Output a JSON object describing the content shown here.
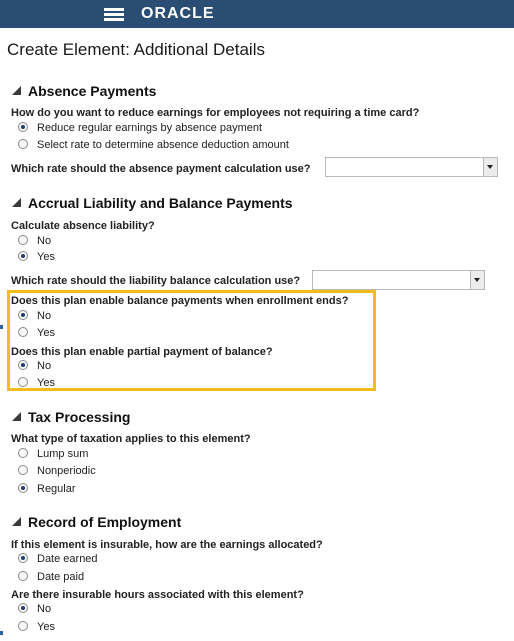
{
  "header": {
    "brand": "ORACLE"
  },
  "page": {
    "title": "Create Element: Additional Details"
  },
  "absence_payments": {
    "title": "Absence Payments",
    "q1": "How do you want to reduce earnings for employees not requiring a time card?",
    "q1_options": [
      "Reduce regular earnings by absence payment",
      "Select rate to determine absence deduction amount"
    ],
    "q2": "Which rate should the absence payment calculation use?",
    "q2_value": ""
  },
  "accrual": {
    "title": "Accrual Liability and Balance Payments",
    "q1": "Calculate absence liability?",
    "q1_options": [
      "No",
      "Yes"
    ],
    "q2": "Which rate should the liability balance calculation use?",
    "q2_value": "",
    "q3": "Does this plan enable balance payments when enrollment ends?",
    "q3_options": [
      "No",
      "Yes"
    ],
    "q4": "Does this plan enable partial payment of balance?",
    "q4_options": [
      "No",
      "Yes"
    ]
  },
  "tax": {
    "title": "Tax Processing",
    "q1": "What type of taxation applies to this element?",
    "q1_options": [
      "Lump sum",
      "Nonperiodic",
      "Regular"
    ]
  },
  "roe": {
    "title": "Record of Employment",
    "q1": "If this element is insurable, how are the earnings allocated?",
    "q1_options": [
      "Date earned",
      "Date paid"
    ],
    "q2": "Are there insurable hours associated with this element?",
    "q2_options": [
      "No",
      "Yes"
    ]
  },
  "colors": {
    "header_bg": "#2a4d73",
    "highlight": "#f2bd1c"
  }
}
